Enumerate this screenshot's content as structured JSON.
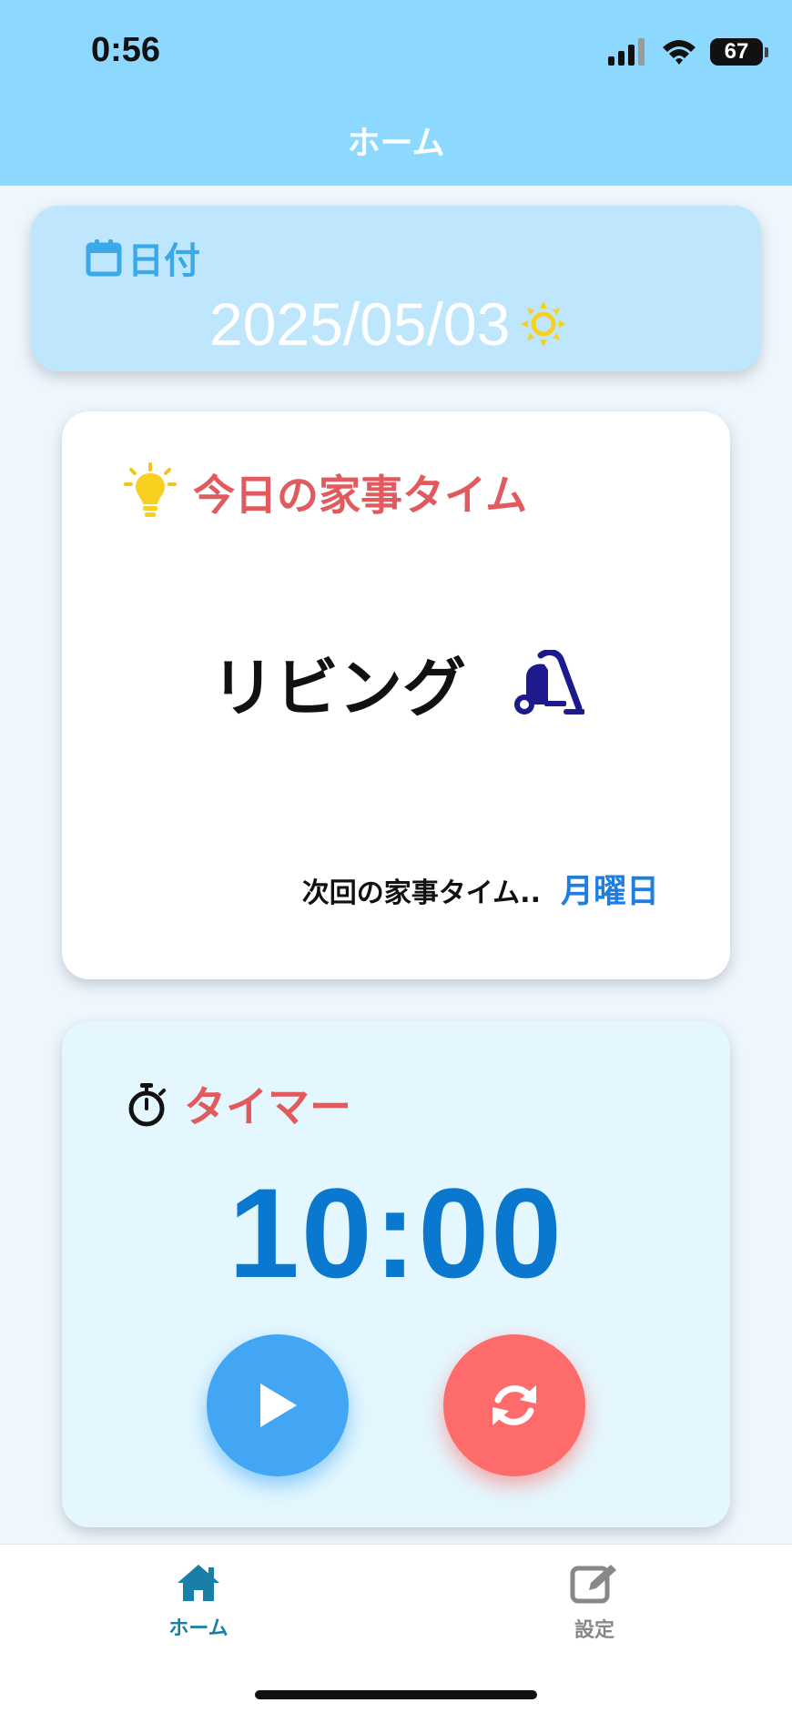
{
  "status_bar": {
    "time": "0:56",
    "battery": "67"
  },
  "header": {
    "title": "ホーム"
  },
  "date_card": {
    "label": "日付",
    "value": "2025/05/03",
    "weather_icon": "sun-icon"
  },
  "chore_card": {
    "title": "今日の家事タイム",
    "room": "リビング",
    "next_label": "次回の家事タイム..",
    "next_day": "月曜日"
  },
  "timer_card": {
    "title": "タイマー",
    "value": "10:00"
  },
  "bottom_nav": {
    "items": [
      {
        "label": "ホーム",
        "icon": "home-icon",
        "active": true
      },
      {
        "label": "設定",
        "icon": "edit-icon",
        "active": false
      }
    ]
  },
  "colors": {
    "header_bg": "#8dd8fe",
    "accent_red": "#e05a5e",
    "timer_blue": "#0a78cf",
    "play_blue": "#42a6f5",
    "reset_red": "#fe6b6b"
  }
}
